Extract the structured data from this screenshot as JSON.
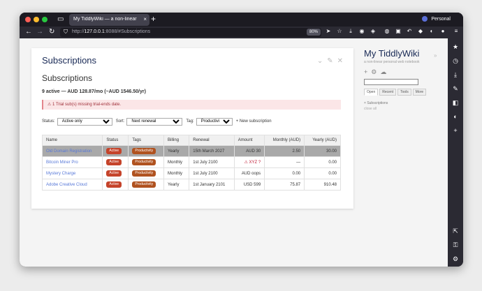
{
  "browser": {
    "tab_title": "My TiddlyWiki — a non-linear personal web notebook",
    "profile_label": "Personal",
    "url_host": "127.0.0.1",
    "url_rest": ":8088/#Subscriptions",
    "url_prefix": "http://",
    "zoom": "80%"
  },
  "tiddler": {
    "title": "Subscriptions",
    "heading": "Subscriptions",
    "summary": "9 active — AUD 128.87/mo (~AUD 1546.50/yr)",
    "warning": "⚠ 1 Trial sub(s) missing trial-ends date.",
    "filters": {
      "status_label": "Status:",
      "status_value": "Active only",
      "sort_label": "Sort:",
      "sort_value": "Next renewal",
      "tag_label": "Tag:",
      "tag_value": "Productivity",
      "new_label": "+ New subscription"
    },
    "table": {
      "headers": [
        "Name",
        "Status",
        "Tags",
        "Billing",
        "Renewal",
        "Amount",
        "Monthly (AUD)",
        "Yearly (AUD)"
      ],
      "rows": [
        {
          "name": "Old Domain Registration",
          "status": "Active",
          "tag": "Productivity",
          "billing": "Yearly",
          "renewal": "15th March 2027",
          "amount": "AUD 30",
          "monthly": "2.50",
          "yearly": "30.00"
        },
        {
          "name": "Bitcoin Miner Pro",
          "status": "Active",
          "tag": "Productivity",
          "billing": "Monthly",
          "renewal": "1st July 2100",
          "amount": "⚠ XYZ ?",
          "monthly": "—",
          "yearly": "0.00"
        },
        {
          "name": "Mystery Charge",
          "status": "Active",
          "tag": "Productivity",
          "billing": "Monthly",
          "renewal": "1st July 2100",
          "amount": "AUD oops",
          "monthly": "0.00",
          "yearly": "0.00"
        },
        {
          "name": "Adobe Creative Cloud",
          "status": "Active",
          "tag": "Productivity",
          "billing": "Yearly",
          "renewal": "1st January 2101",
          "amount": "USD 599",
          "monthly": "75.87",
          "yearly": "910.48"
        }
      ]
    }
  },
  "sidebar": {
    "title": "My TiddlyWiki",
    "subtitle": "a non-linear personal web notebook",
    "tabs": [
      "Open",
      "Recent",
      "Tools",
      "More"
    ],
    "open_item": "Subscriptions",
    "close_all": "close all"
  },
  "colors": {
    "status_badge": "#c5432a",
    "tag_badge": "#b0521f",
    "link": "#5778d8",
    "title": "#182955"
  }
}
